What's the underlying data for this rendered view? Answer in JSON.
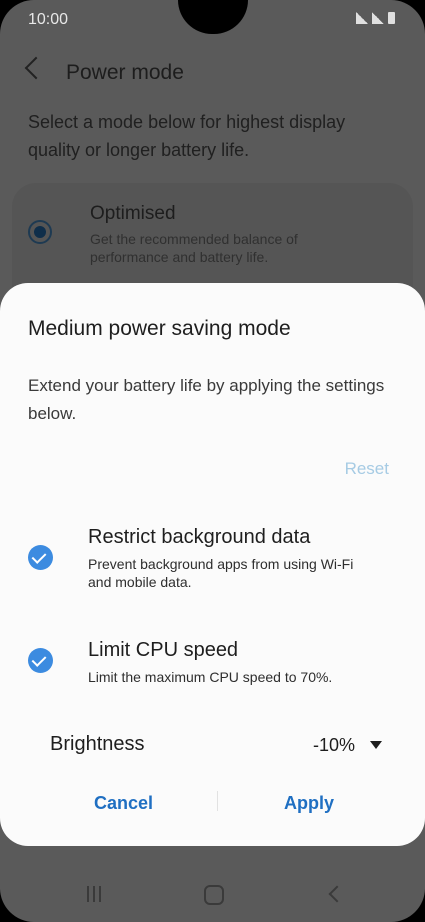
{
  "status_bar": {
    "time": "10:00"
  },
  "background": {
    "title": "Power mode",
    "description": "Select a mode below for highest display quality or longer battery life.",
    "option": {
      "title": "Optimised",
      "subtitle": "Get the recommended balance of performance and battery life.",
      "selected": true
    }
  },
  "dialog": {
    "title": "Medium power saving mode",
    "description": "Extend your battery life by applying the settings below.",
    "reset_label": "Reset",
    "settings": [
      {
        "title": "Restrict background data",
        "subtitle": "Prevent background apps from using Wi-Fi and mobile data.",
        "checked": true
      },
      {
        "title": "Limit CPU speed",
        "subtitle": "Limit the maximum CPU speed to 70%.",
        "checked": true
      }
    ],
    "brightness": {
      "label": "Brightness",
      "value": "-10%"
    },
    "cancel_label": "Cancel",
    "apply_label": "Apply"
  },
  "colors": {
    "accent": "#1f6fc2",
    "check": "#3c8be0",
    "reset_disabled": "#a6cbe4",
    "scrim": "#5a5a5a"
  },
  "icons": [
    "back-arrow-icon",
    "signal-icon",
    "battery-icon",
    "radio-selected-icon",
    "check-icon",
    "dropdown-caret-icon",
    "recents-icon",
    "home-icon",
    "nav-back-icon"
  ]
}
